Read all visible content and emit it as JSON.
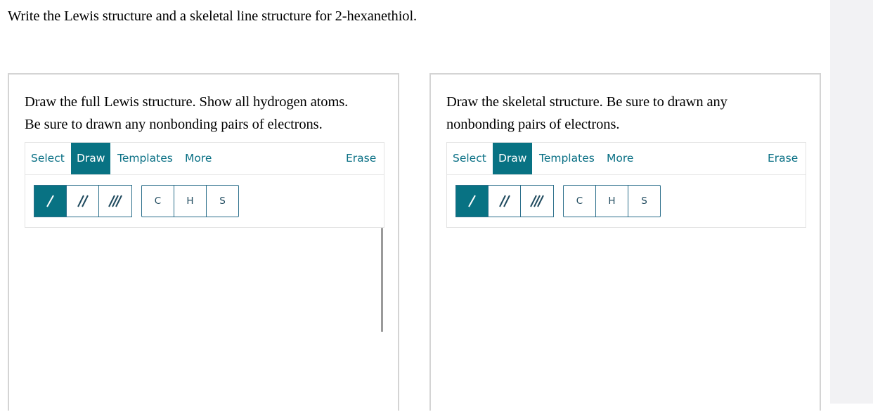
{
  "question": "Write the Lewis structure and a skeletal line structure for 2-hexanethiol.",
  "panels": [
    {
      "instructions_line1": "Draw the full Lewis structure. Show all hydrogen atoms.",
      "instructions_line2": "Be sure to drawn any nonbonding pairs of electrons.",
      "menu": {
        "select": "Select",
        "draw": "Draw",
        "templates": "Templates",
        "more": "More",
        "erase": "Erase"
      },
      "active_menu": "Draw",
      "bond_tools": [
        "single-bond",
        "double-bond",
        "triple-bond"
      ],
      "active_bond": "single-bond",
      "atoms": [
        "C",
        "H",
        "S"
      ]
    },
    {
      "instructions_line1": "Draw the skeletal structure. Be sure to drawn any",
      "instructions_line2": "nonbonding pairs of electrons.",
      "menu": {
        "select": "Select",
        "draw": "Draw",
        "templates": "Templates",
        "more": "More",
        "erase": "Erase"
      },
      "active_menu": "Draw",
      "bond_tools": [
        "single-bond",
        "double-bond",
        "triple-bond"
      ],
      "active_bond": "single-bond",
      "atoms": [
        "C",
        "H",
        "S"
      ]
    }
  ],
  "colors": {
    "accent": "#087283",
    "link": "#0a7085",
    "border": "#2c6f8b"
  }
}
